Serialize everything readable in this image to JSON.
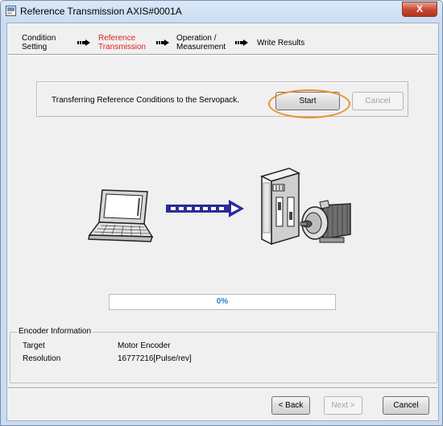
{
  "window": {
    "title": "Reference Transmission AXIS#0001A",
    "close_label": "X"
  },
  "steps": [
    {
      "line1": "Condition",
      "line2": "Setting"
    },
    {
      "line1": "Reference",
      "line2": "Transmission"
    },
    {
      "line1": "Operation /",
      "line2": "Measurement"
    },
    {
      "line1": "Write Results",
      "line2": ""
    }
  ],
  "transfer": {
    "message": "Transferring Reference Conditions to the Servopack.",
    "start_label": "Start",
    "cancel_label": "Cancel"
  },
  "progress": {
    "percent": 0,
    "label": "0%"
  },
  "encoder_info": {
    "title": "Encoder Information",
    "target_label": "Target",
    "target_value": "Motor Encoder",
    "resolution_label": "Resolution",
    "resolution_value": "16777216[Pulse/rev]"
  },
  "footer": {
    "back_label": "< Back",
    "next_label": "Next >",
    "cancel_label": "Cancel"
  },
  "colors": {
    "active_step": "#e02020",
    "highlight_oval": "#e8922a",
    "transfer_arrow": "#2b2b9c"
  }
}
